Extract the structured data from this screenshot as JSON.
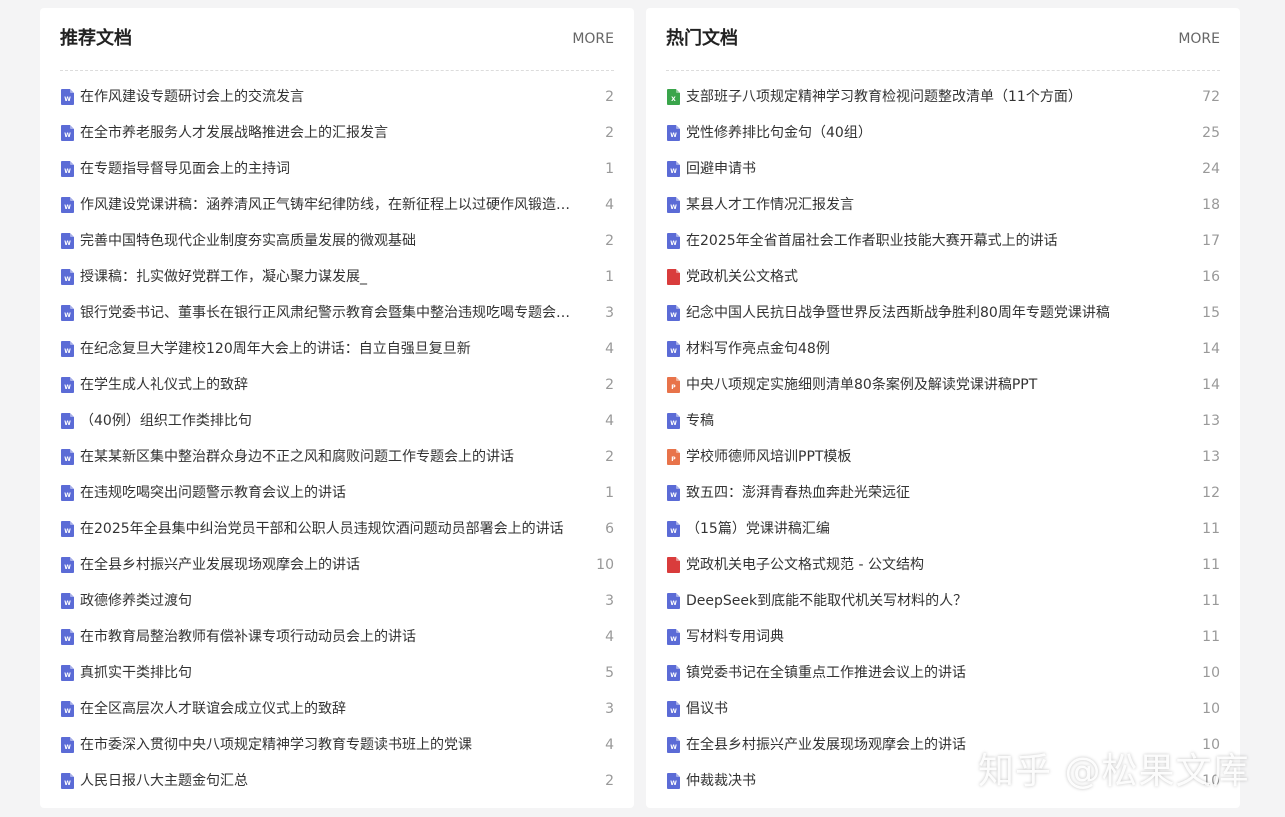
{
  "file_type_colors": {
    "word": "#5b6bd6",
    "excel": "#3aa54b",
    "pdf": "#d93c3c",
    "ppt": "#e8734a"
  },
  "recommended": {
    "title": "推荐文档",
    "more": "MORE",
    "items": [
      {
        "title": "在作风建设专题研讨会上的交流发言",
        "count": "2",
        "type": "word"
      },
      {
        "title": "在全市养老服务人才发展战略推进会上的汇报发言",
        "count": "2",
        "type": "word"
      },
      {
        "title": "在专题指导督导见面会上的主持词",
        "count": "1",
        "type": "word"
      },
      {
        "title": "作风建设党课讲稿：涵养清风正气铸牢纪律防线，在新征程上以过硬作风锻造忠诚干净担当的干部队伍",
        "count": "4",
        "type": "word"
      },
      {
        "title": "完善中国特色现代企业制度夯实高质量发展的微观基础",
        "count": "2",
        "type": "word"
      },
      {
        "title": "授课稿：扎实做好党群工作，凝心聚力谋发展_",
        "count": "1",
        "type": "word"
      },
      {
        "title": "银行党委书记、董事长在银行正风肃纪警示教育会暨集中整治违规吃喝专题会上的讲话",
        "count": "3",
        "type": "word"
      },
      {
        "title": "在纪念复旦大学建校120周年大会上的讲话：自立自强旦复旦新",
        "count": "4",
        "type": "word"
      },
      {
        "title": "在学生成人礼仪式上的致辞",
        "count": "2",
        "type": "word"
      },
      {
        "title": "（40例）组织工作类排比句",
        "count": "4",
        "type": "word"
      },
      {
        "title": "在某某新区集中整治群众身边不正之风和腐败问题工作专题会上的讲话",
        "count": "2",
        "type": "word"
      },
      {
        "title": "在违规吃喝突出问题警示教育会议上的讲话",
        "count": "1",
        "type": "word"
      },
      {
        "title": "在2025年全县集中纠治党员干部和公职人员违规饮酒问题动员部署会上的讲话",
        "count": "6",
        "type": "word"
      },
      {
        "title": "在全县乡村振兴产业发展现场观摩会上的讲话",
        "count": "10",
        "type": "word"
      },
      {
        "title": "政德修养类过渡句",
        "count": "3",
        "type": "word"
      },
      {
        "title": "在市教育局整治教师有偿补课专项行动动员会上的讲话",
        "count": "4",
        "type": "word"
      },
      {
        "title": "真抓实干类排比句",
        "count": "5",
        "type": "word"
      },
      {
        "title": "在全区高层次人才联谊会成立仪式上的致辞",
        "count": "3",
        "type": "word"
      },
      {
        "title": "在市委深入贯彻中央八项规定精神学习教育专题读书班上的党课",
        "count": "4",
        "type": "word"
      },
      {
        "title": "人民日报八大主题金句汇总",
        "count": "2",
        "type": "word"
      }
    ]
  },
  "hot": {
    "title": "热门文档",
    "more": "MORE",
    "items": [
      {
        "title": "支部班子八项规定精神学习教育检视问题整改清单（11个方面）",
        "count": "72",
        "type": "excel"
      },
      {
        "title": "党性修养排比句金句（40组）",
        "count": "25",
        "type": "word"
      },
      {
        "title": "回避申请书",
        "count": "24",
        "type": "word"
      },
      {
        "title": "某县人才工作情况汇报发言",
        "count": "18",
        "type": "word"
      },
      {
        "title": "在2025年全省首届社会工作者职业技能大赛开幕式上的讲话",
        "count": "17",
        "type": "word"
      },
      {
        "title": "党政机关公文格式",
        "count": "16",
        "type": "pdf"
      },
      {
        "title": "纪念中国人民抗日战争暨世界反法西斯战争胜利80周年专题党课讲稿",
        "count": "15",
        "type": "word"
      },
      {
        "title": "材料写作亮点金句48例",
        "count": "14",
        "type": "word"
      },
      {
        "title": "中央八项规定实施细则清单80条案例及解读党课讲稿PPT",
        "count": "14",
        "type": "ppt"
      },
      {
        "title": "专稿",
        "count": "13",
        "type": "word"
      },
      {
        "title": "学校师德师风培训PPT模板",
        "count": "13",
        "type": "ppt"
      },
      {
        "title": "致五四：澎湃青春热血奔赴光荣远征",
        "count": "12",
        "type": "word"
      },
      {
        "title": "（15篇）党课讲稿汇编",
        "count": "11",
        "type": "word"
      },
      {
        "title": "党政机关电子公文格式规范 - 公文结构",
        "count": "11",
        "type": "pdf"
      },
      {
        "title": "DeepSeek到底能不能取代机关写材料的人？",
        "count": "11",
        "type": "word"
      },
      {
        "title": "写材料专用词典",
        "count": "11",
        "type": "word"
      },
      {
        "title": "镇党委书记在全镇重点工作推进会议上的讲话",
        "count": "10",
        "type": "word"
      },
      {
        "title": "倡议书",
        "count": "10",
        "type": "word"
      },
      {
        "title": "在全县乡村振兴产业发展现场观摩会上的讲话",
        "count": "10",
        "type": "word"
      },
      {
        "title": "仲裁裁决书",
        "count": "10",
        "type": "word"
      }
    ]
  },
  "watermark": "知乎 @松果文库"
}
